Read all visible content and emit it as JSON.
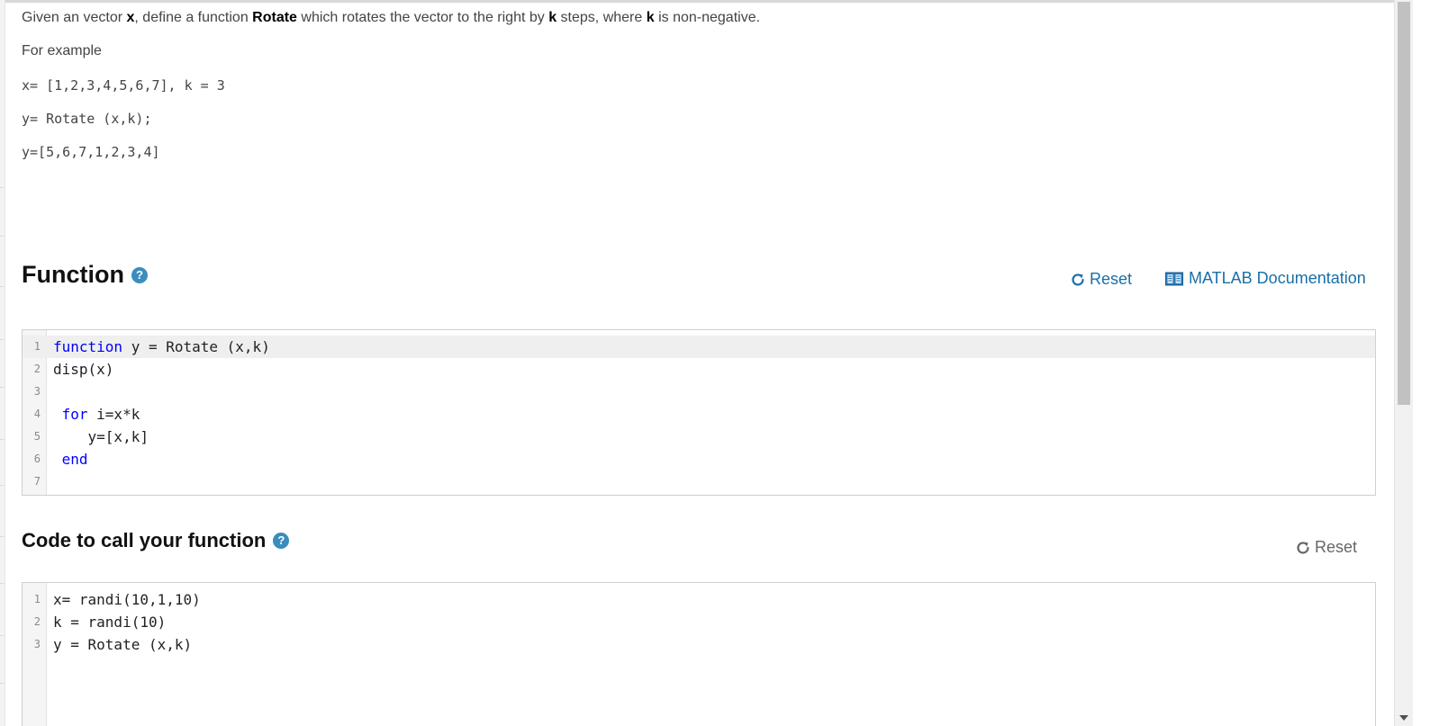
{
  "description": {
    "line1_parts": [
      "Given an vector ",
      "x",
      ", define a function ",
      "Rotate",
      " which rotates the vector to the right by ",
      "k",
      " steps, where ",
      "k",
      " is non-negative."
    ],
    "for_example": "For example",
    "example_lines": [
      "x= [1,2,3,4,5,6,7], k = 3",
      "y= Rotate (x,k);",
      "y=[5,6,7,1,2,3,4]"
    ]
  },
  "function_section": {
    "title": "Function",
    "help_icon": "question-icon",
    "reset_label": "Reset",
    "docs_label": "MATLAB Documentation",
    "code_lines": [
      {
        "num": "1",
        "kw": "function",
        "rest": " y = Rotate (x,k)"
      },
      {
        "num": "2",
        "kw": "",
        "rest": "disp(x)"
      },
      {
        "num": "3",
        "kw": "",
        "rest": ""
      },
      {
        "num": "4",
        "kw": " for",
        "rest": " i=x*k"
      },
      {
        "num": "5",
        "kw": "",
        "rest": "    y=[x,k]"
      },
      {
        "num": "6",
        "kw": " end",
        "rest": ""
      },
      {
        "num": "7",
        "kw": "",
        "rest": ""
      }
    ]
  },
  "call_section": {
    "title": "Code to call your function",
    "help_icon": "question-icon",
    "reset_label": "Reset",
    "code_lines": [
      {
        "num": "1",
        "kw": "",
        "rest": "x= randi(10,1,10)"
      },
      {
        "num": "2",
        "kw": "",
        "rest": "k = randi(10)"
      },
      {
        "num": "3",
        "kw": "",
        "rest": "y = Rotate (x,k)"
      }
    ]
  },
  "colors": {
    "link": "#1a6fa8",
    "keyword": "#0000ff",
    "help_icon": "#3b8dbd"
  }
}
